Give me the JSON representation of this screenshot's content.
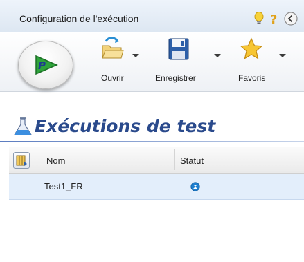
{
  "window": {
    "title": "Configuration de l'exécution",
    "icons": [
      "lightbulb-icon",
      "help-icon",
      "back-icon"
    ]
  },
  "toolbar": {
    "run": {
      "icon": "run-play-icon"
    },
    "open": {
      "label": "Ouvrir",
      "icon": "open-folder-icon"
    },
    "save": {
      "label": "Enregistrer",
      "icon": "floppy-disk-icon"
    },
    "favorites": {
      "label": "Favoris",
      "icon": "star-icon"
    }
  },
  "section": {
    "title": "Exécutions de test",
    "icon": "flask-icon"
  },
  "grid": {
    "columns": [
      "Nom",
      "Statut"
    ],
    "rows": [
      {
        "name": "Test1_FR",
        "status_icon": "status-pending-icon"
      }
    ]
  },
  "colors": {
    "title_accent": "#2a4a8c",
    "selected_row": "#e3eefb",
    "status_blue": "#1e7fd0"
  }
}
